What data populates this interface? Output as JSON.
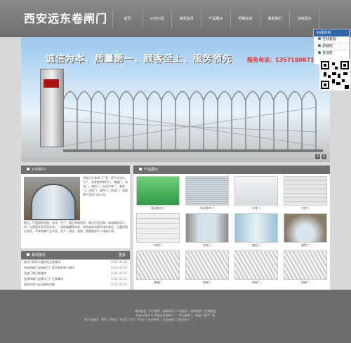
{
  "header": {
    "logo": "西安远东卷闸门",
    "nav": [
      "首页",
      "公司介绍",
      "新闻资讯",
      "产品展示",
      "招聘信息",
      "联系我们",
      "在线留言"
    ]
  },
  "online": {
    "title": "在线咨询",
    "online_label": "在线客服",
    "qq1": "讲越旺",
    "qq2": "普通帮"
  },
  "banner": {
    "slogan": "诚信为本、质量第一、顾客至上、服务领先",
    "phone": "服务电话：13571808712",
    "prev": "<",
    "next": ">"
  },
  "about": {
    "title": "公司简介",
    "text": "西安远东卷闸门厂是一家专业设计、生产、安装各种卷帘门、伸缩门、电动门、感应门、自动车库门、卷帘门、车库门、遥控门、防盗门、道闸等产品的门业公司。",
    "text2": "能见，严格按照质量、设计、生产、施工四道程序，精心打造品牌，诚诚服务用户。本厂以满意技术开拓市场，一流质量赢得市场，优质服务巩固市场为宗旨。注重质量与技术，不断完善产品开发、生产、测试、质检、销售服务为一体流水线。"
  },
  "news": {
    "title": "新闻资讯",
    "more": "更多",
    "items": [
      {
        "text": "卷帘门保养与维护的注意事项",
        "date": "2015-06-19"
      },
      {
        "text": "电动伸缩门设施施工厂商全新安装与调试",
        "date": "2015-06-19"
      },
      {
        "text": "防盗门的日常维修",
        "date": "2015-06-06"
      },
      {
        "text": "选择伸缩门品牌与门厂注意事项",
        "date": "2015-06-11"
      },
      {
        "text": "选购车库门应注意的问题",
        "date": "2015-05-11"
      }
    ]
  },
  "products": {
    "title": "产品展示",
    "items": [
      {
        "name": "电动卷帘门",
        "kind": "green"
      },
      {
        "name": "电动卷帘门",
        "kind": "shutter"
      },
      {
        "name": "车库门",
        "kind": "white"
      },
      {
        "name": "车库门",
        "kind": "garage"
      },
      {
        "name": "车库门",
        "kind": "garage2"
      },
      {
        "name": "车库门",
        "kind": "doorway"
      },
      {
        "name": "感应门",
        "kind": "glass"
      },
      {
        "name": "旋转门",
        "kind": "revolving"
      },
      {
        "name": "伸缩门",
        "kind": "gate"
      },
      {
        "name": "伸缩门",
        "kind": "gate"
      },
      {
        "name": "伸缩门",
        "kind": "gate"
      },
      {
        "name": "伸缩门",
        "kind": "gate"
      }
    ]
  },
  "footer": {
    "links": "网站首页 | 关于我们 | 新闻资讯 | 产品展示 | 联系我们 | 在线留言",
    "copy": "Copyright © 西安远东卷闸门 — 专业卷闸门、电动门生产厂家",
    "tags": "热门关键词：卷帘门 伸缩门 电动门 车库门 防盗门 西安卷帘门 西安伸缩门 西安电动门"
  }
}
